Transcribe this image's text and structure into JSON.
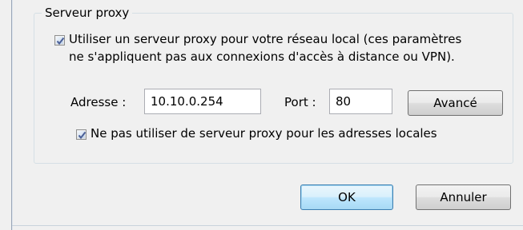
{
  "proxy_group": {
    "legend": "Serveur proxy",
    "use_proxy": {
      "checked": true,
      "label_line1": "Utiliser un serveur proxy pour votre réseau local (ces paramètres",
      "label_line2": "ne s'appliquent pas aux connexions d'accès à distance ou VPN)."
    },
    "address_label": "Adresse :",
    "address_value": "10.10.0.254",
    "port_label": "Port :",
    "port_value": "80",
    "advanced_button": "Avancé",
    "bypass_local": {
      "checked": true,
      "label": "Ne pas utiliser de serveur proxy pour les adresses locales"
    }
  },
  "dialog_buttons": {
    "ok": "OK",
    "cancel": "Annuler"
  }
}
